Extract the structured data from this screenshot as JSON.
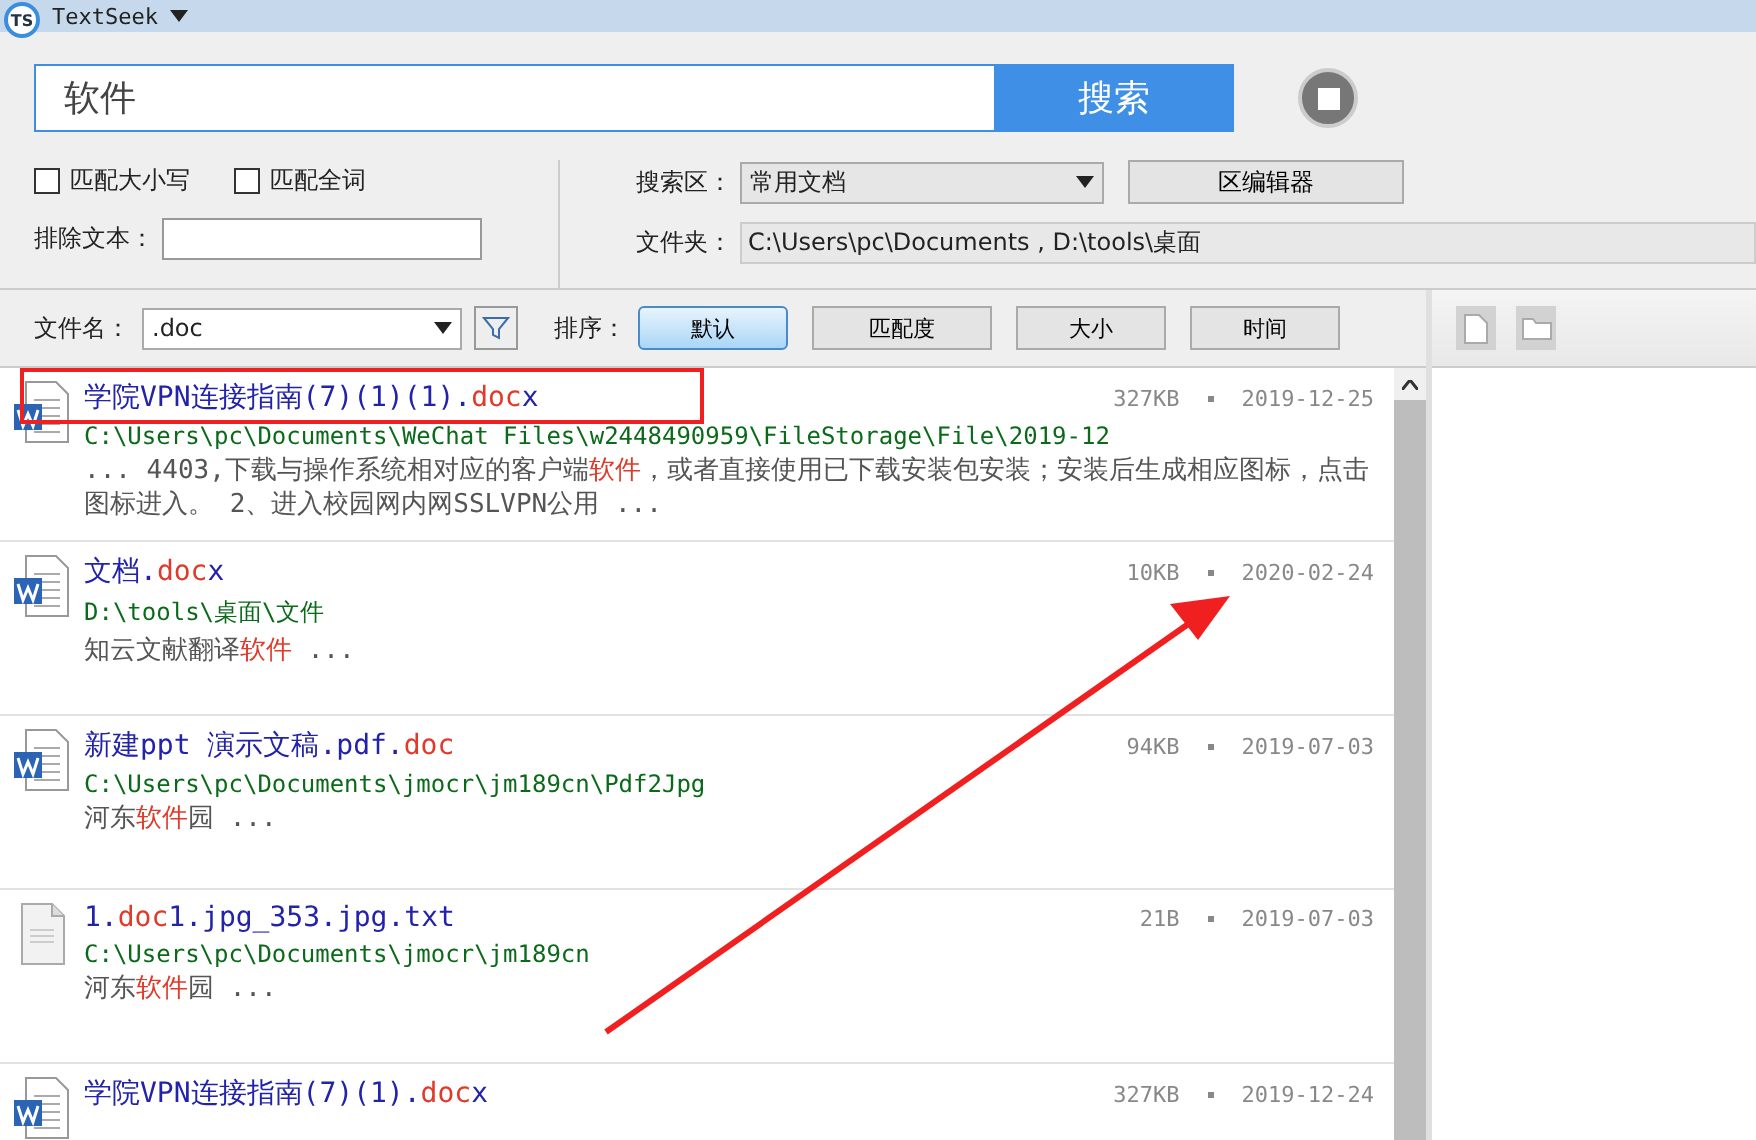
{
  "app": {
    "logo": "TS",
    "title": "TextSeek"
  },
  "search": {
    "value": "软件",
    "button": "搜索"
  },
  "options": {
    "checkboxes": [
      {
        "label": "匹配大小写",
        "checked": false
      },
      {
        "label": "匹配全词",
        "checked": false
      }
    ],
    "exclude_label": "排除文本：",
    "area_label": "搜索区：",
    "area_value": "常用文档",
    "area_button": "区编辑器",
    "folder_label": "文件夹：",
    "folder_value": "C:\\Users\\pc\\Documents , D:\\tools\\桌面"
  },
  "filter": {
    "label": "文件名：",
    "value": ".doc"
  },
  "sort": {
    "label": "排序：",
    "buttons": [
      {
        "label": "默认",
        "selected": true
      },
      {
        "label": "匹配度",
        "selected": false
      },
      {
        "label": "大小",
        "selected": false
      },
      {
        "label": "时间",
        "selected": false
      }
    ]
  },
  "results": [
    {
      "kind": "word",
      "outlined": true,
      "name": [
        {
          "text": "学院VPN连接指南(7)(1)(1).",
          "match": false
        },
        {
          "text": "doc",
          "match": true
        },
        {
          "text": "x",
          "match": false
        }
      ],
      "size": "327KB",
      "date": "2019-12-25",
      "path": "C:\\Users\\pc\\Documents\\WeChat Files\\w2448490959\\FileStorage\\File\\2019-12",
      "snippet": [
        {
          "text": "... 4403,下载与操作系统相对应的客户端",
          "match": false
        },
        {
          "text": "软件",
          "match": true
        },
        {
          "text": "，或者直接使用已下载安装包安装；安装后生成相应图标，点击图标进入。 2、进入校园网内网SSLVPN公用 ...",
          "match": false
        }
      ]
    },
    {
      "kind": "word",
      "outlined": false,
      "name": [
        {
          "text": "文档.",
          "match": false
        },
        {
          "text": "doc",
          "match": true
        },
        {
          "text": "x",
          "match": false
        }
      ],
      "size": "10KB",
      "date": "2020-02-24",
      "path": "D:\\tools\\桌面\\文件",
      "snippet": [
        {
          "text": "知云文献翻译",
          "match": false
        },
        {
          "text": "软件",
          "match": true
        },
        {
          "text": " ...",
          "match": false
        }
      ]
    },
    {
      "kind": "word",
      "outlined": false,
      "name": [
        {
          "text": "新建ppt 演示文稿.pdf.",
          "match": false
        },
        {
          "text": "doc",
          "match": true
        }
      ],
      "size": "94KB",
      "date": "2019-07-03",
      "path": "C:\\Users\\pc\\Documents\\jmocr\\jm189cn\\Pdf2Jpg",
      "snippet": [
        {
          "text": "河东",
          "match": false
        },
        {
          "text": "软件",
          "match": true
        },
        {
          "text": "园 ...",
          "match": false
        }
      ]
    },
    {
      "kind": "text",
      "outlined": false,
      "name": [
        {
          "text": "1.",
          "match": false
        },
        {
          "text": "doc",
          "match": true
        },
        {
          "text": "1.jpg_353.jpg.txt",
          "match": false
        }
      ],
      "size": "21B",
      "date": "2019-07-03",
      "path": "C:\\Users\\pc\\Documents\\jmocr\\jm189cn",
      "snippet": [
        {
          "text": " 河东",
          "match": false
        },
        {
          "text": "软件",
          "match": true
        },
        {
          "text": "园 ...",
          "match": false
        }
      ]
    },
    {
      "kind": "word",
      "outlined": false,
      "name": [
        {
          "text": "学院VPN连接指南(7)(1).",
          "match": false
        },
        {
          "text": "doc",
          "match": true
        },
        {
          "text": "x",
          "match": false
        }
      ],
      "size": "327KB",
      "date": "2019-12-24"
    }
  ]
}
